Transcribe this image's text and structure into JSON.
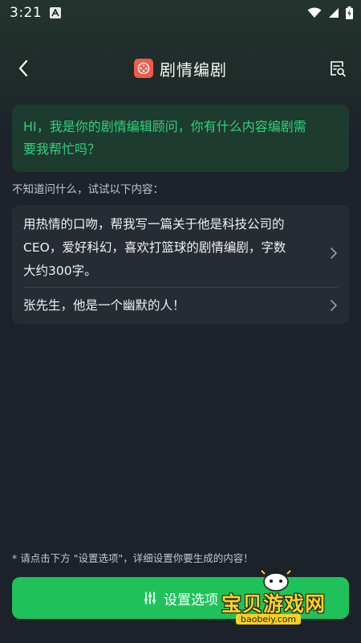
{
  "status_bar": {
    "time": "3:21",
    "icons": [
      "notification-a-icon",
      "wifi-icon",
      "signal-icon",
      "battery-icon"
    ]
  },
  "header": {
    "title": "剧情编剧",
    "back_icon": "back-arrow-icon",
    "history_icon": "history-search-icon"
  },
  "greeting": {
    "line1": "HI，我是你的剧情编辑顾问，你有什么内容编剧需",
    "line2": "要我帮忙吗？"
  },
  "hint": "不知道问什么，试试以下内容：",
  "suggestions": [
    {
      "line1": "用热情的口吻，帮我写一篇关于他是科技公司的",
      "line2": "CEO，爱好科幻，喜欢打篮球的剧情编剧，字数",
      "line3": "大约300字。"
    },
    {
      "line1": "张先生，他是一个幽默的人！"
    }
  ],
  "footer": {
    "note": "* 请点击下方 \"设置选项\"，详细设置你要生成的内容！",
    "button_label": "设置选项"
  },
  "watermark": {
    "text": "宝贝游戏网",
    "url": "baobeiy.com"
  },
  "colors": {
    "accent_green": "#1fc25a",
    "greeting_text": "#2ed47a",
    "logo_red": "#f25b4a",
    "background": "#1c2229"
  }
}
